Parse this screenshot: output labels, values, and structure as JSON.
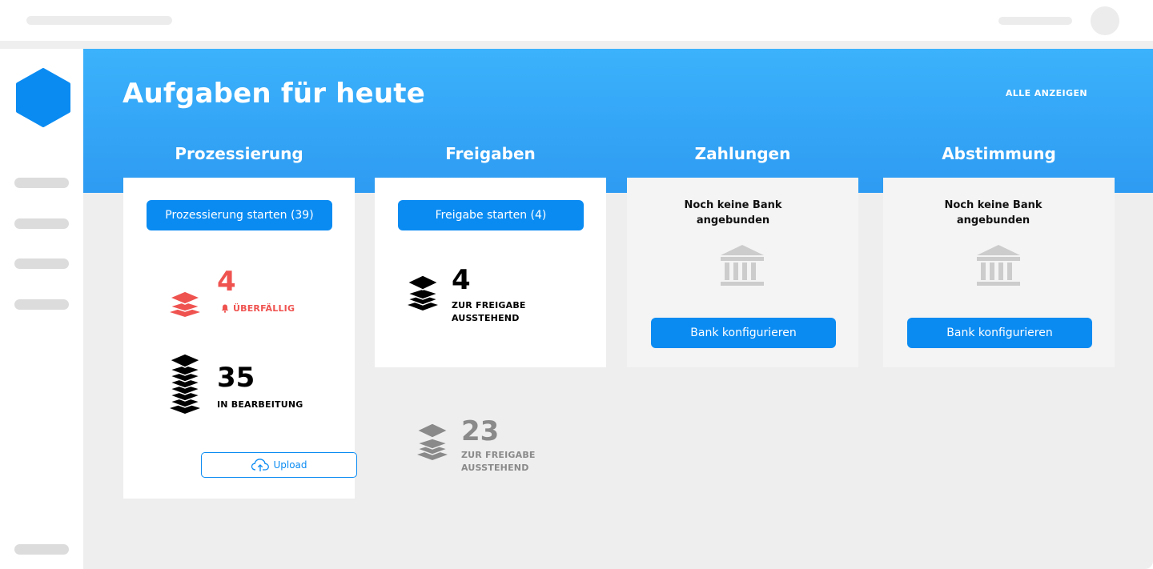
{
  "header": {
    "title": "Aufgaben für heute",
    "show_all": "ALLE ANZEIGEN"
  },
  "columns": [
    {
      "title": "Prozessierung"
    },
    {
      "title": "Freigaben"
    },
    {
      "title": "Zahlungen"
    },
    {
      "title": "Abstimmung"
    }
  ],
  "processing": {
    "start_button": "Prozessierung starten (39)",
    "overdue_count": "4",
    "overdue_label": "ÜBERFÄLLIG",
    "in_progress_count": "35",
    "in_progress_label": "IN BEARBEITUNG",
    "upload_label": "Upload"
  },
  "approvals": {
    "start_button": "Freigabe starten (4)",
    "pending_count": "4",
    "pending_label_1": "ZUR FREIGABE",
    "pending_label_2": "AUSSTEHEND",
    "other_count": "23",
    "other_label_1": "ZUR FREIGABE",
    "other_label_2": "AUSSTEHEND"
  },
  "payments": {
    "no_bank_1": "Noch keine Bank",
    "no_bank_2": "angebunden",
    "button": "Bank konfigurieren"
  },
  "reconciliation": {
    "no_bank_1": "Noch keine Bank",
    "no_bank_2": "angebunden",
    "button": "Bank konfigurieren"
  },
  "colors": {
    "accent": "#0a8bf2",
    "banner": "#35a8f8",
    "overdue": "#ef5350",
    "muted": "#8a8a8a"
  }
}
